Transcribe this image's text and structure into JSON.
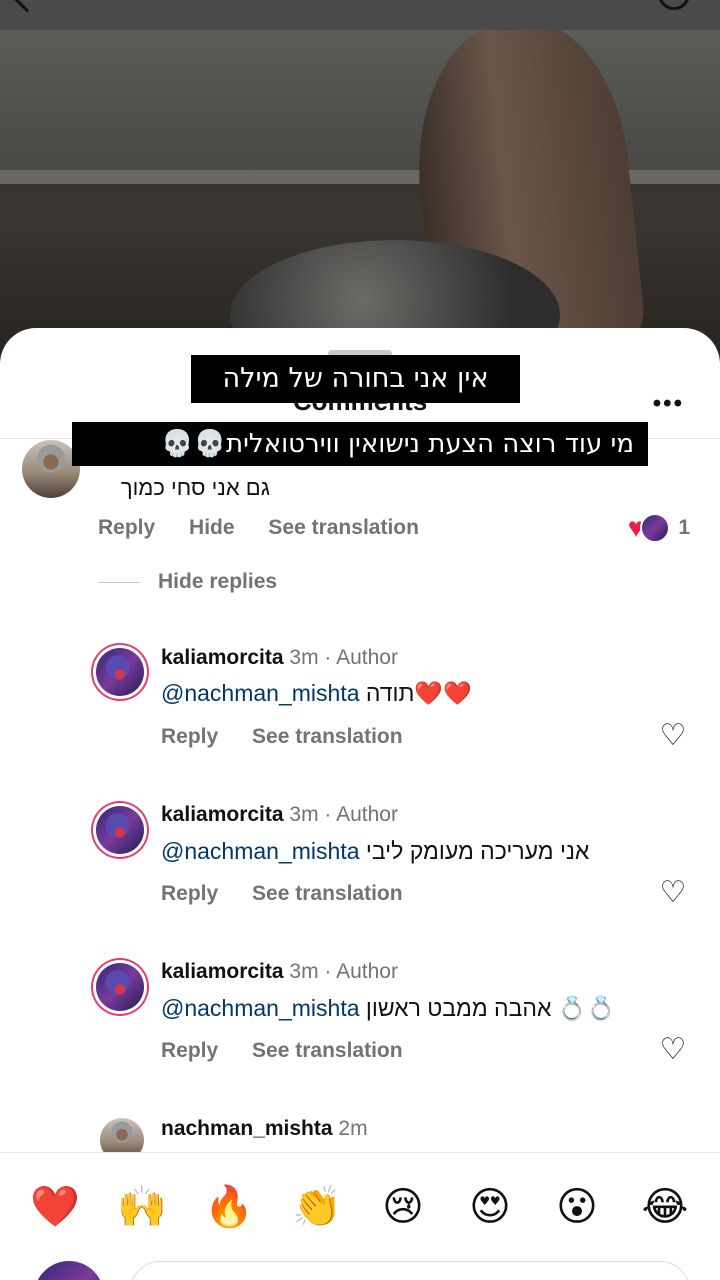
{
  "sheet": {
    "title": "Comments"
  },
  "captions": {
    "line1": "אין אני בחורה של מילה",
    "line2_text": "מי עוד רוצה הצעת נישואין ווירטואלית",
    "line2_emoji": "💀💀"
  },
  "main_comment": {
    "text": "גם אני סחי כמוך",
    "actions": {
      "reply": "Reply",
      "hide": "Hide",
      "translate": "See translation"
    },
    "like_count": "1"
  },
  "hide_replies_label": "Hide replies",
  "replies": [
    {
      "user": "kaliamorcita",
      "meta": "3m · Author",
      "mention": "@nachman_mishta",
      "text": "תודה",
      "emoji": "❤️❤️",
      "reply": "Reply",
      "translate": "See translation"
    },
    {
      "user": "kaliamorcita",
      "meta": "3m · Author",
      "mention": "@nachman_mishta",
      "text": "אני מעריכה מעומק ליבי",
      "emoji": "",
      "reply": "Reply",
      "translate": "See translation"
    },
    {
      "user": "kaliamorcita",
      "meta": "3m · Author",
      "mention": "@nachman_mishta",
      "text": "אהבה ממבט ראשון",
      "emoji": "💍💍",
      "reply": "Reply",
      "translate": "See translation"
    },
    {
      "user": "nachman_mishta",
      "meta": "2m"
    }
  ],
  "emoji_bar": [
    "❤️",
    "🙌",
    "🔥",
    "👏",
    "😢",
    "😍",
    "😮",
    "😂"
  ],
  "colors": {
    "mention": "#00376b",
    "heart": "#ee1d3f",
    "secondary_text": "#737373"
  }
}
